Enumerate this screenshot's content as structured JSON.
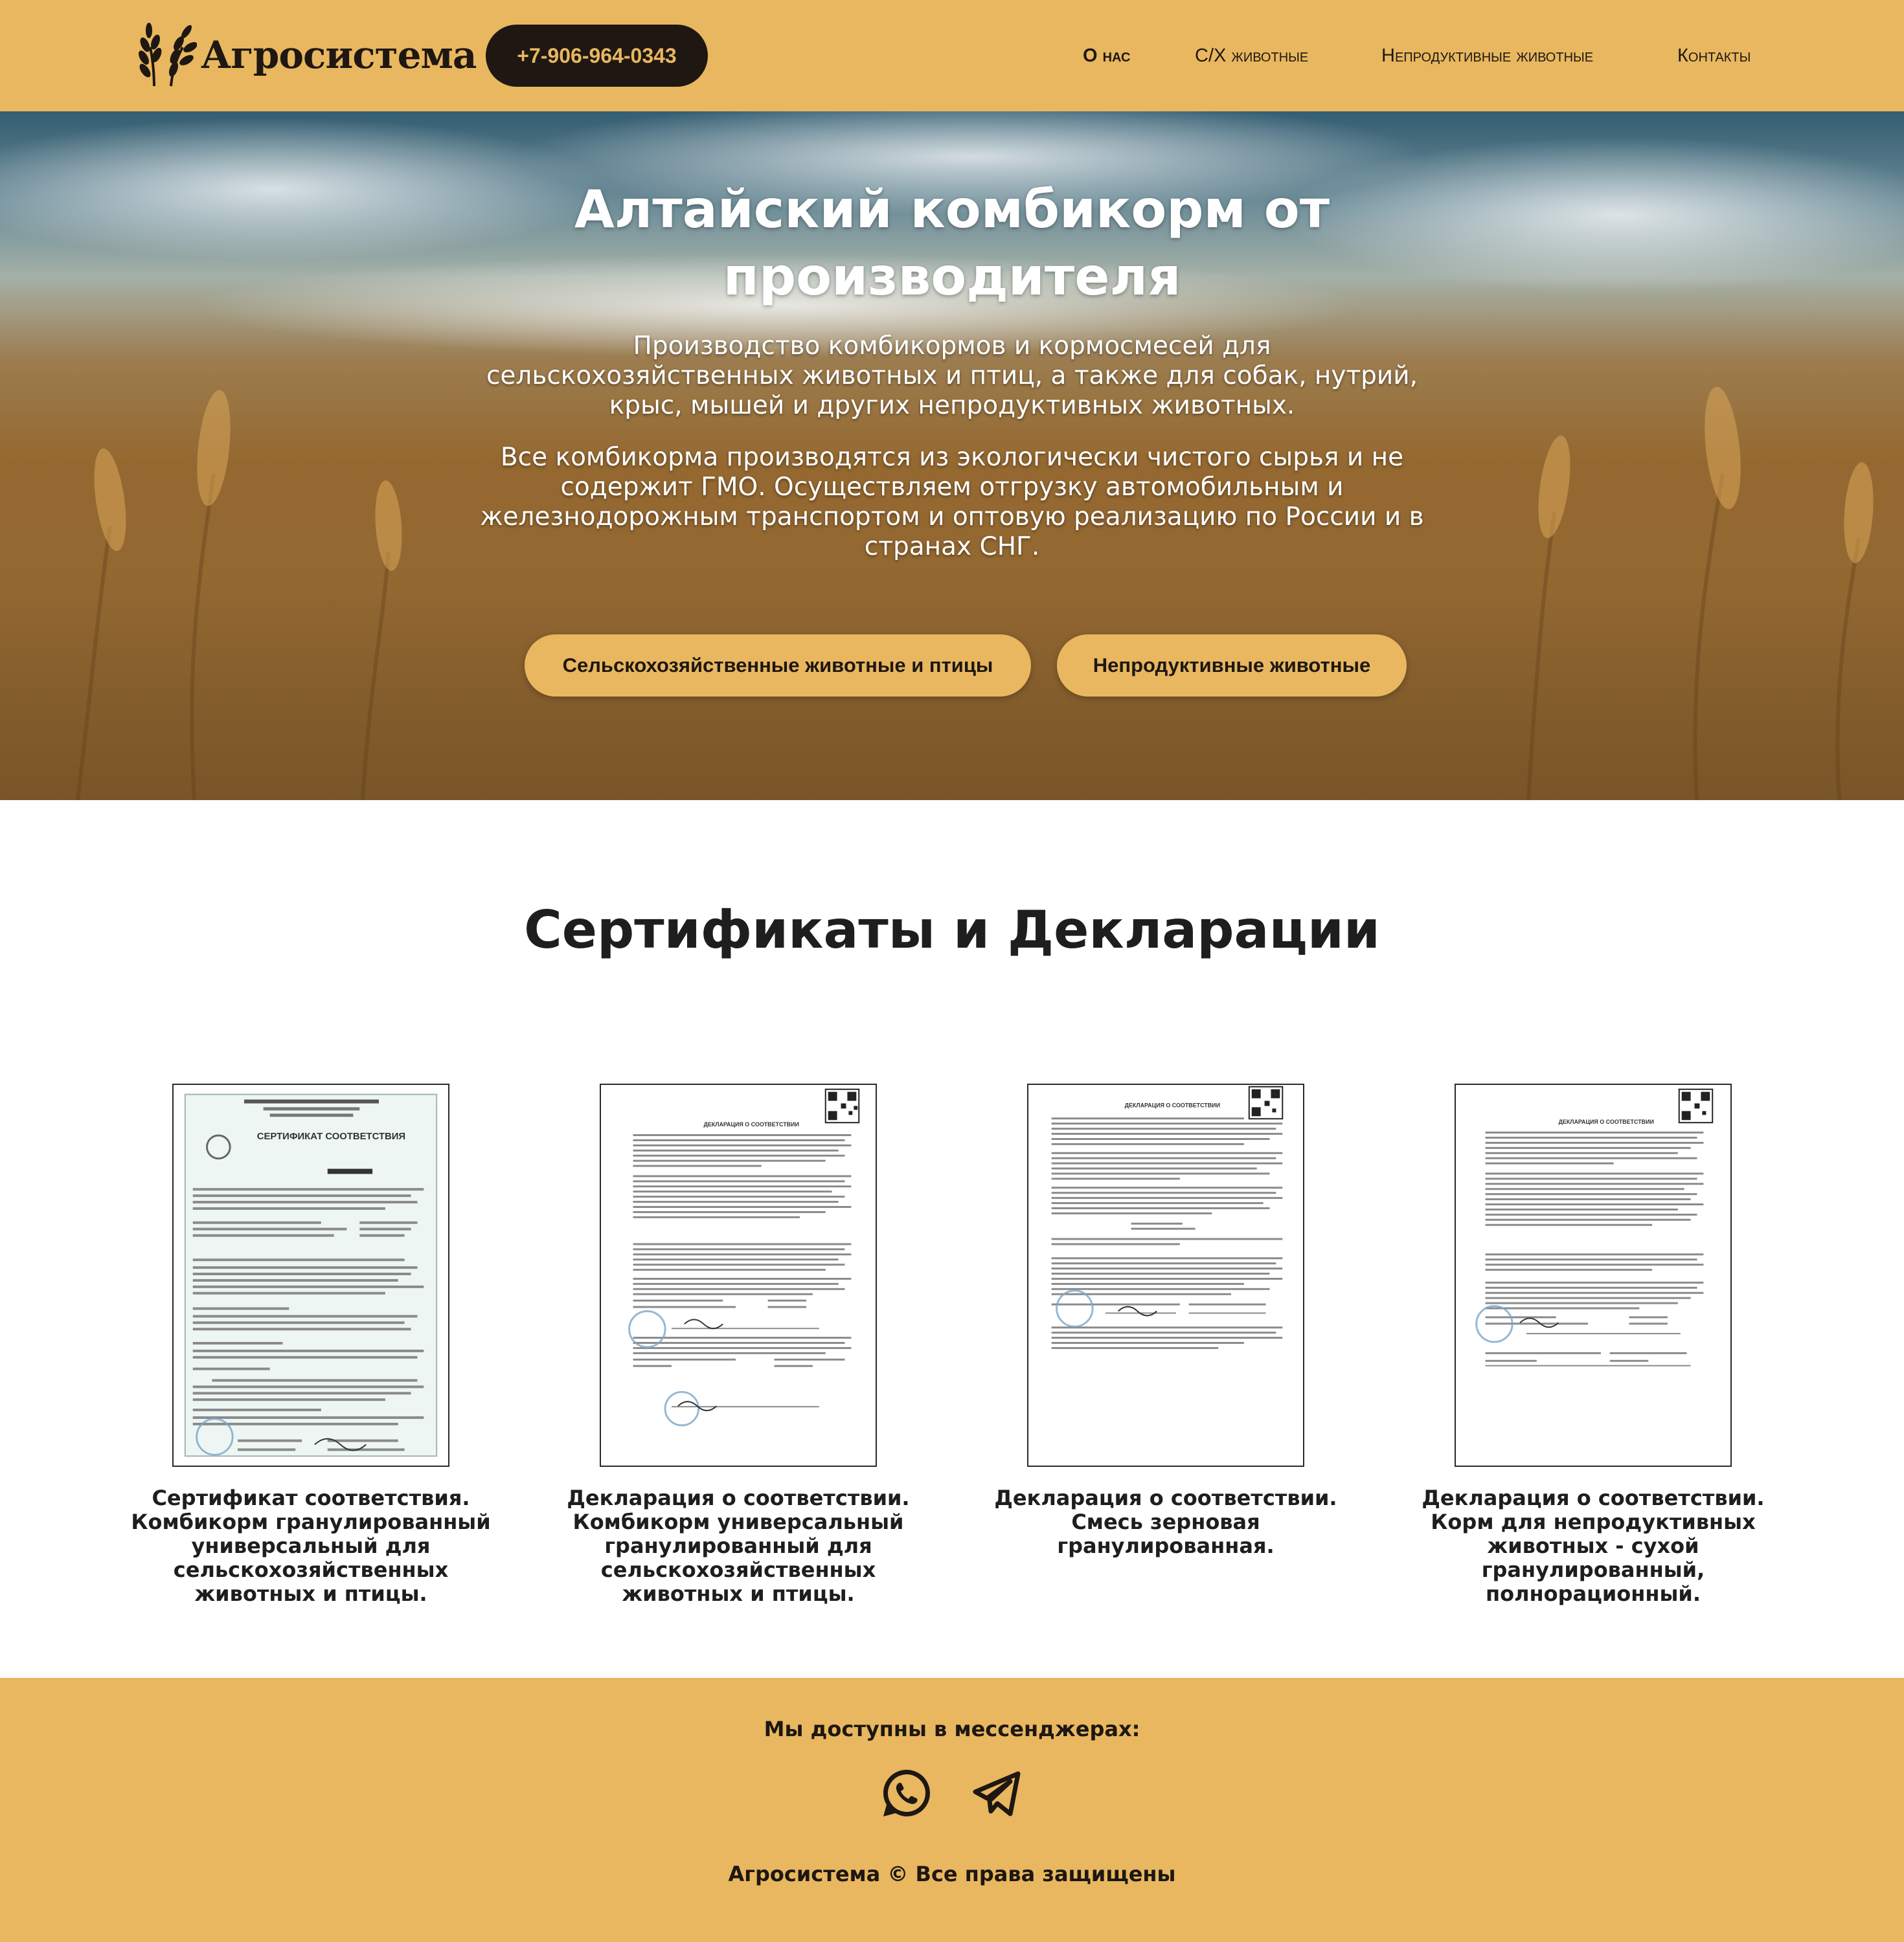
{
  "header": {
    "brand": "Агросистема",
    "phone": "+7-906-964-0343",
    "nav": [
      {
        "label": "О нас"
      },
      {
        "label": "С/Х животные"
      },
      {
        "label": "Непродуктивные животные"
      },
      {
        "label": "Контакты"
      }
    ]
  },
  "hero": {
    "title": "Алтайский комбикорм от производителя",
    "paragraph1": "Производство комбикормов и кормосмесей для сельскохозяйственных животных и птиц, а также для собак, нутрий, крыс, мышей и других непродуктивных животных.",
    "paragraph2": "Все комбикорма производятся из экологически чистого сырья и не содержит ГМО. Осуществляем отгрузку автомобильным и железнодорожным транспортом и оптовую реализацию по России и в странах СНГ.",
    "buttons": [
      {
        "label": "Сельскохозяйственные животные и птицы"
      },
      {
        "label": "Непродуктивные животные"
      }
    ]
  },
  "certificates": {
    "title": "Сертификаты и Декларации",
    "items": [
      {
        "caption": "Сертификат соответствия. Комбикорм гранулированный универсальный для сельскохозяйственных животных и птицы.",
        "doc_heading": "СЕРТИФИКАТ СООТВЕТСТВИЯ"
      },
      {
        "caption": "Декларация о соответствии. Комбикорм универсальный гранулированный для сельскохозяйственных животных и птицы.",
        "doc_heading": "ДЕКЛАРАЦИЯ О СООТВЕТСТВИИ"
      },
      {
        "caption": "Декларация о соответствии. Смесь зерновая гранулированная.",
        "doc_heading": "ДЕКЛАРАЦИЯ О СООТВЕТСТВИИ"
      },
      {
        "caption": "Декларация о соответствии. Корм для непродуктивных животных - сухой гранулированный, полнорационный.",
        "doc_heading": "ДЕКЛАРАЦИЯ О СООТВЕТСТВИИ"
      }
    ]
  },
  "footer": {
    "messengers_title": "Мы доступны в мессенджерах:",
    "messengers": [
      {
        "icon": "whatsapp-icon"
      },
      {
        "icon": "telegram-icon"
      }
    ],
    "copyright": "Агросистема © Все права защищены"
  },
  "colors": {
    "accent": "#e8b75f",
    "dark": "#1e1712",
    "text": "#1e1e1e"
  }
}
